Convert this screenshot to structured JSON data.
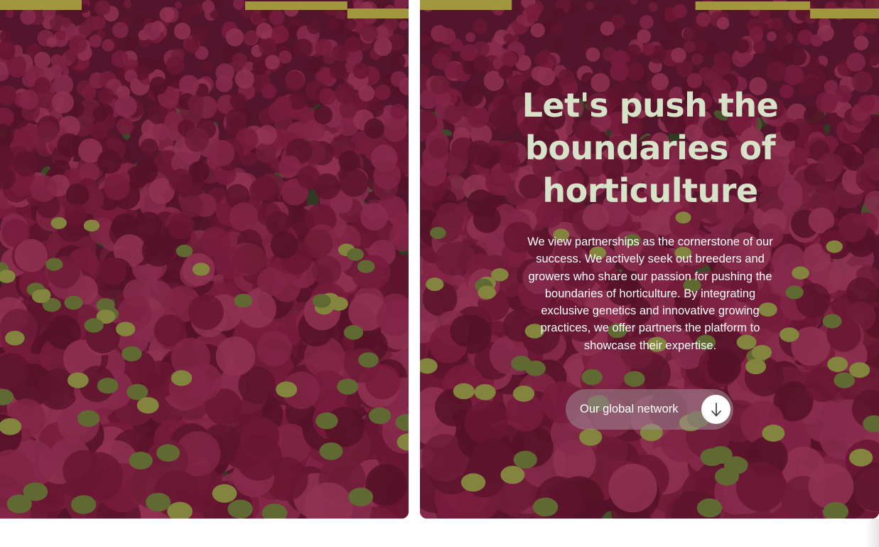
{
  "hero": {
    "title": "Let's push the boundaries of horticulture",
    "body": "We view partnerships as the cornerstone of our success. We actively seek out breeders and growers who share our passion for pushing the boundaries of horticulture. By integrating exclusive genetics and innovative growing practices, we offer partners the platform to showcase their expertise.",
    "cta_label": "Our global network",
    "cta_icon": "arrow-down-icon"
  },
  "colors": {
    "title": "#d6e3c8",
    "body": "#ffffff",
    "flower_dark": "#6d1734",
    "flower_mid": "#8e1f45",
    "foliage": "#3e5a2c",
    "bench_yellow": "#d9d84a"
  },
  "images": {
    "left_panel": "hydrangea-greenhouse-photo",
    "right_panel": "hydrangea-greenhouse-photo"
  }
}
